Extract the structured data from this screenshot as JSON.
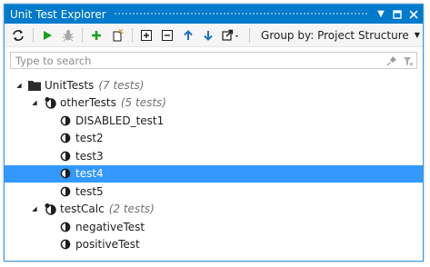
{
  "window": {
    "title": "Unit Test Explorer"
  },
  "toolbar": {
    "group_by_label": "Group by: Project Structure"
  },
  "search": {
    "placeholder": "Type to search"
  },
  "tree": {
    "root": {
      "label": "UnitTests",
      "count": "(7 tests)"
    },
    "group1": {
      "label": "otherTests",
      "count": "(5 tests)",
      "items": [
        "DISABLED_test1",
        "test2",
        "test3",
        "test4",
        "test5"
      ]
    },
    "group2": {
      "label": "testCalc",
      "count": "(2 tests)",
      "items": [
        "negativeTest",
        "positiveTest"
      ]
    }
  },
  "colors": {
    "titlebar": "#007acc",
    "selection": "#3399ff",
    "run_green": "#1e9e1e",
    "arrow_blue": "#1e6fc8"
  }
}
